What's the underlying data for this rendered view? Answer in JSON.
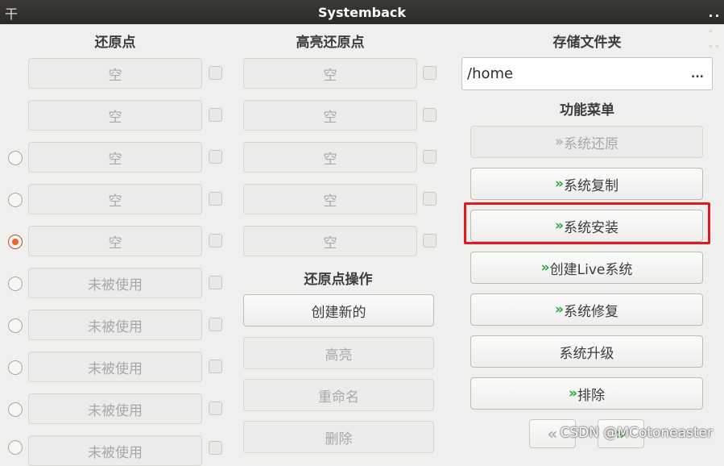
{
  "window": {
    "title": "Systemback"
  },
  "restore_points": {
    "heading": "还原点",
    "slots": [
      "空",
      "空",
      "空",
      "空",
      "空",
      "未被使用",
      "未被使用",
      "未被使用",
      "未被使用",
      "未被使用"
    ]
  },
  "highlighted_points": {
    "heading": "高亮还原点",
    "slots": [
      "空",
      "空",
      "空",
      "空",
      "空"
    ]
  },
  "restore_ops": {
    "heading": "还原点操作",
    "create": "创建新的",
    "highlight": "高亮",
    "rename": "重命名",
    "delete": "删除"
  },
  "storage": {
    "heading": "存储文件夹",
    "path": "/home",
    "browse": "..."
  },
  "function_menu": {
    "heading": "功能菜单",
    "items": [
      "系统还原",
      "系统复制",
      "系统安装",
      "创建Live系统",
      "系统修复",
      "系统升级",
      "排除"
    ],
    "chevron": "»"
  },
  "watermark": "CSDN @MCotoneaster",
  "colors": {
    "accent_green": "#2fa83a",
    "highlight_red": "#e01b1b",
    "radio_orange": "#e9652b"
  }
}
